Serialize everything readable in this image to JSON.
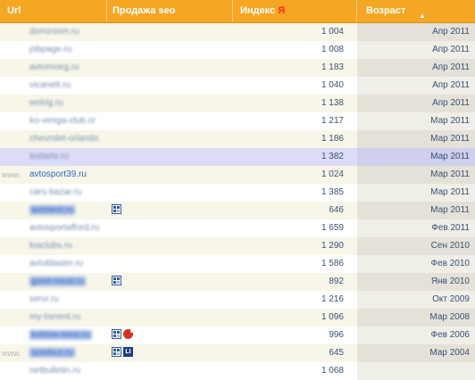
{
  "header": {
    "url_label": "Url",
    "seo_label": "Продажа seo",
    "index_label": "Индекс",
    "index_ya": "Я",
    "age_label": "Возраст",
    "sort_arrow": "▲"
  },
  "colors": {
    "header_bg": "#f5a623",
    "link": "#2f67c4",
    "value": "#3a5173",
    "highlight_row": "#dcdcf7"
  },
  "rows": [
    {
      "url": "domzoom.ru",
      "index": "1 004",
      "age": "Апр 2011"
    },
    {
      "url": "jobpage.ru",
      "index": "1 008",
      "age": "Апр 2011"
    },
    {
      "url": "avtomoeg.ru",
      "index": "1 183",
      "age": "Апр 2011"
    },
    {
      "url": "vicanett.ru",
      "index": "1 040",
      "age": "Апр 2011"
    },
    {
      "url": "welrig.ru",
      "index": "1 138",
      "age": "Апр 2011"
    },
    {
      "url": "ko-venga-club.cr",
      "index": "1 217",
      "age": "Мар 2011"
    },
    {
      "url": "chevrolet-orlando",
      "index": "1 186",
      "age": "Мар 2011"
    },
    {
      "url": "lestarts.ru",
      "index": "1 382",
      "age": "Мар 2011"
    },
    {
      "url": "avtosport39.ru",
      "www": "www.",
      "index": "1 024",
      "age": "Мар 2011"
    },
    {
      "url": "cars-bazar.ru",
      "index": "1 385",
      "age": "Мар 2011"
    },
    {
      "url": "autotest.ru",
      "index": "646",
      "age": "Мар 2011"
    },
    {
      "url": "avtosportafford.ru",
      "index": "1 659",
      "age": "Фев 2011"
    },
    {
      "url": "kiaclubs.ru",
      "index": "1 290",
      "age": "Сен 2010"
    },
    {
      "url": "avtoblaster.ru",
      "index": "1 586",
      "age": "Фев 2010"
    },
    {
      "url": "good-meal.ru",
      "index": "892",
      "age": "Янв 2010"
    },
    {
      "url": "servi.ru",
      "index": "1 216",
      "age": "Окт 2009"
    },
    {
      "url": "my-torrent.ru",
      "index": "1 096",
      "age": "Мар 2008"
    },
    {
      "url": "kuhnia-mesi.ru",
      "index": "996",
      "age": "Фев 2006"
    },
    {
      "url": "autobuz.ru",
      "www": "www.",
      "index": "645",
      "age": "Мар 2004"
    },
    {
      "url": "netbulletin.ru",
      "index": "1 068",
      "age": ""
    }
  ]
}
